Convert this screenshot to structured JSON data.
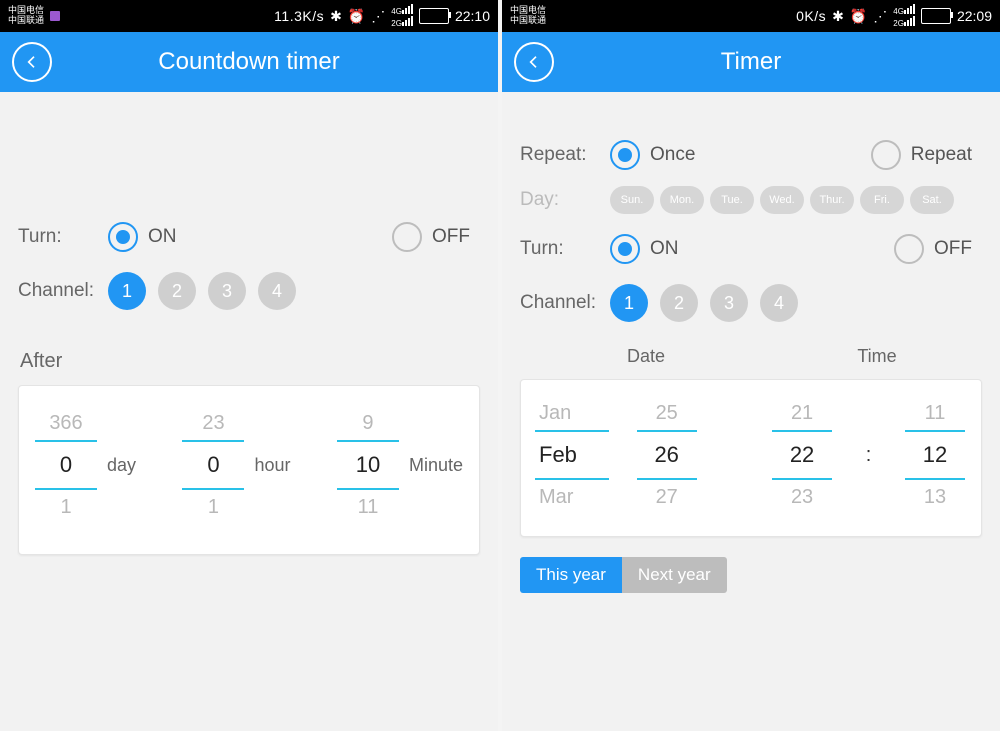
{
  "left": {
    "status": {
      "carrier1": "中国电信",
      "carrier2": "中国联通",
      "rate": "11.3K/s",
      "net1": "4G",
      "net2": "2G",
      "time": "22:10"
    },
    "title": "Countdown timer",
    "turn": {
      "label": "Turn:",
      "on": "ON",
      "off": "OFF",
      "active": "on"
    },
    "channel": {
      "label": "Channel:",
      "options": [
        "1",
        "2",
        "3",
        "4"
      ],
      "active": 0
    },
    "after": {
      "label": "After",
      "day": {
        "prev": "366",
        "value": "0",
        "next": "1",
        "unit": "day"
      },
      "hour": {
        "prev": "23",
        "value": "0",
        "next": "1",
        "unit": "hour"
      },
      "minute": {
        "prev": "9",
        "value": "10",
        "next": "11",
        "unit": "Minute"
      }
    }
  },
  "right": {
    "status": {
      "carrier1": "中国电信",
      "carrier2": "中国联通",
      "rate": "0K/s",
      "net1": "4G",
      "net2": "2G",
      "time": "22:09"
    },
    "title": "Timer",
    "repeat": {
      "label": "Repeat:",
      "once": "Once",
      "repeat": "Repeat",
      "active": "once"
    },
    "day": {
      "label": "Day:",
      "chips": [
        "Sun.",
        "Mon.",
        "Tue.",
        "Wed.",
        "Thur.",
        "Fri.",
        "Sat."
      ]
    },
    "turn": {
      "label": "Turn:",
      "on": "ON",
      "off": "OFF",
      "active": "on"
    },
    "channel": {
      "label": "Channel:",
      "options": [
        "1",
        "2",
        "3",
        "4"
      ],
      "active": 0
    },
    "header": {
      "date": "Date",
      "time": "Time"
    },
    "picker": {
      "month": {
        "prev": "Jan",
        "value": "Feb",
        "next": "Mar"
      },
      "dayNum": {
        "prev": "25",
        "value": "26",
        "next": "27"
      },
      "hour": {
        "prev": "21",
        "value": "22",
        "next": "23"
      },
      "minute": {
        "prev": "11",
        "value": "12",
        "next": "13"
      },
      "colon": ":"
    },
    "year": {
      "this": "This year",
      "next": "Next year",
      "active": "this"
    }
  }
}
